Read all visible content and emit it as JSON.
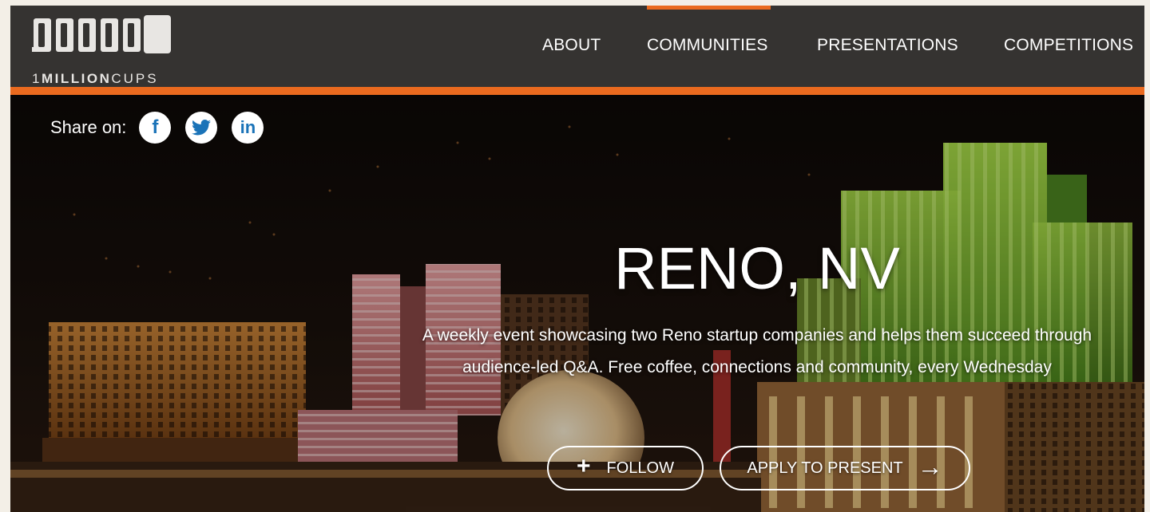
{
  "logo": {
    "text_bold": "MILLION",
    "text_prefix": "1",
    "text_light": "CUPS"
  },
  "nav": {
    "items": [
      {
        "label": "ABOUT"
      },
      {
        "label": "COMMUNITIES"
      },
      {
        "label": "PRESENTATIONS"
      },
      {
        "label": "COMPETITIONS"
      }
    ],
    "active": "COMMUNITIES"
  },
  "share": {
    "label": "Share on:",
    "networks": [
      {
        "name": "facebook",
        "glyph": "f"
      },
      {
        "name": "twitter",
        "glyph": "t"
      },
      {
        "name": "linkedin",
        "glyph": "in"
      }
    ]
  },
  "hero": {
    "title": "RENO, NV",
    "description": "A weekly event showcasing two Reno startup companies and helps them succeed through audience-led Q&A. Free coffee, connections and community, every Wednesday",
    "follow_label": "FOLLOW",
    "apply_label": "APPLY TO PRESENT"
  },
  "colors": {
    "accent": "#ea6a1f",
    "header_bg": "#353331",
    "social_blue": "#1a73b8"
  }
}
